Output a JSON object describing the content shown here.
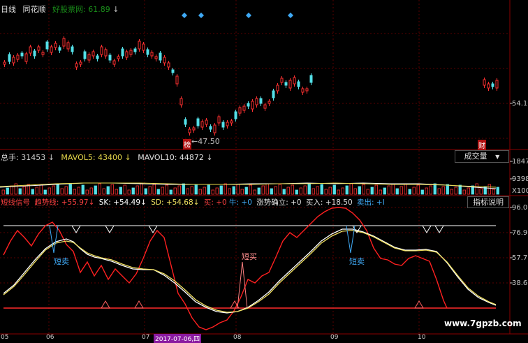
{
  "header": {
    "period": "日线",
    "source": "同花顺",
    "ticker_label": "好股票网",
    "ticker_value": ": 61.89",
    "ticker_arrow": "↓"
  },
  "price_panel": {
    "price_tag": "54.10",
    "low_label": "←47.50",
    "low_badge": "榜",
    "fin_badge": "财"
  },
  "volume_panel": {
    "total": "总手: 31453",
    "total_arrow": "↓",
    "mavol5": "MAVOL5: 43400",
    "mavol5_arrow": "↓",
    "mavol10": "MAVOL10: 44872",
    "mavol10_arrow": "↓",
    "dropdown_label": "成交量",
    "dropdown_icon": "▼",
    "axis_top": "1847",
    "axis_mid": "9398",
    "axis_low": "X100"
  },
  "indicator_panel": {
    "name": "短线信号",
    "trend": "趋势线: +55.97",
    "trend_arrow": "↓",
    "sk": "SK: +54.49",
    "sk_arrow": "↓",
    "sd": "SD: +54.68",
    "sd_arrow": "↓",
    "buy": "买: +0",
    "cow": "牛: +0",
    "trend_confirm": "涨势确立: +0",
    "buy_in": "买入: +18.50",
    "sell_out": "卖出: +I",
    "explain_button": "指标说明",
    "axis": [
      "96.0",
      "76.9",
      "57.7",
      "38.6"
    ],
    "sell_tag_1": "短卖",
    "buy_tag": "短买",
    "sell_tag_2": "短卖"
  },
  "date_axis": {
    "ticks": [
      "05",
      "06",
      "07",
      "2017-07-06,四",
      "08",
      "09",
      "10"
    ]
  },
  "watermark": "www.7gpzb.com"
}
